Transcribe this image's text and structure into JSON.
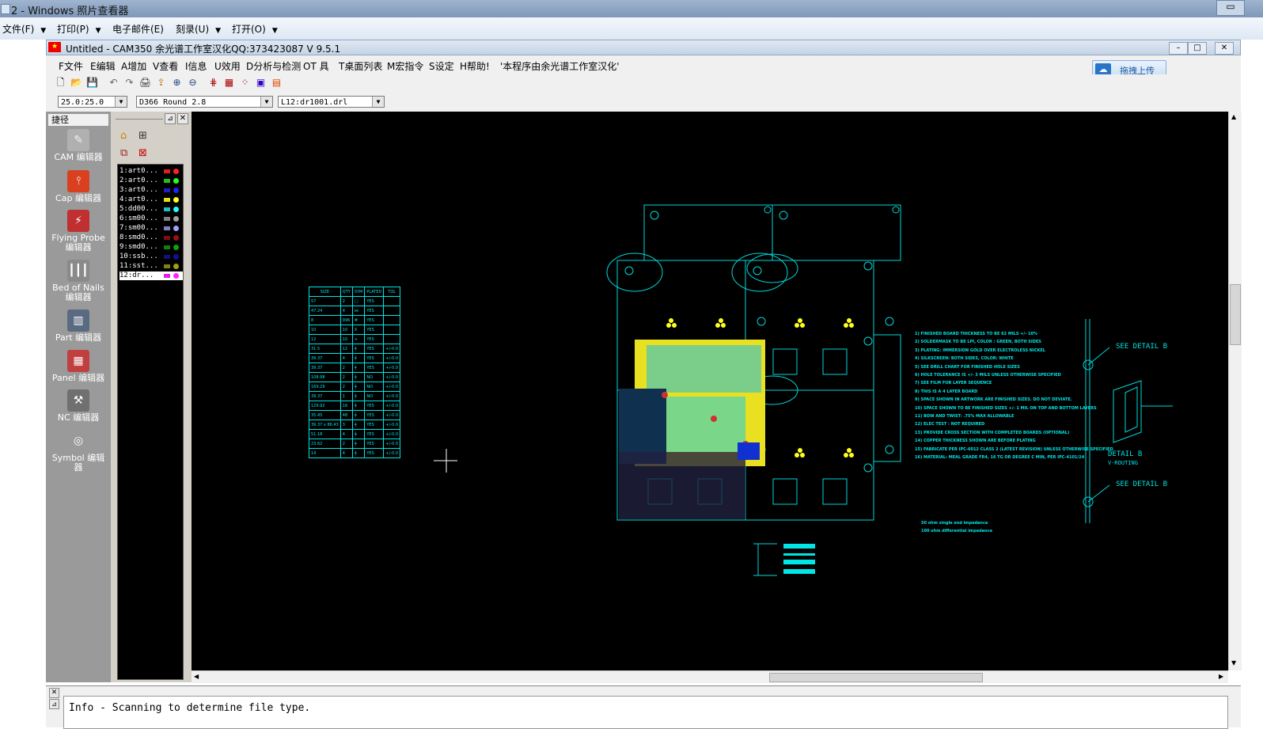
{
  "outer": {
    "title": "2 - Windows 照片查看器",
    "menu": [
      {
        "label": "文件(F)"
      },
      {
        "label": "打印(P)"
      },
      {
        "label": "电子邮件(E)"
      },
      {
        "label": "刻录(U)"
      },
      {
        "label": "打开(O)"
      }
    ]
  },
  "cam": {
    "title": "Untitled - CAM350 余光谱工作室汉化QQ:373423087 V 9.5.1",
    "menu": [
      "F文件",
      "E编辑",
      "A增加",
      "V查看",
      "I信息",
      "U效用",
      "D分析与检测",
      "OT 具",
      "T桌面列表",
      "M宏指令",
      "S设定",
      "H帮助!",
      "'本程序由余光谱工作室汉化'"
    ],
    "upload_button": "拖拽上传",
    "combos": {
      "grid": "25.0:25.0",
      "dcode": "D366  Round 2.8",
      "layer": "L12:dr1001.drl"
    },
    "panel_title": "捷径",
    "editors": [
      {
        "label": "CAM 编辑器",
        "icon": "cam-editor-icon"
      },
      {
        "label": "Cap 编辑器",
        "icon": "cap-editor-icon"
      },
      {
        "label": "Flying Probe 编辑器",
        "icon": "flying-probe-icon"
      },
      {
        "label": "Bed of Nails 编辑器",
        "icon": "bed-of-nails-icon"
      },
      {
        "label": "Part 编辑器",
        "icon": "part-editor-icon"
      },
      {
        "label": "Panel 编辑器",
        "icon": "panel-editor-icon"
      },
      {
        "label": "NC 编辑器",
        "icon": "nc-editor-icon"
      },
      {
        "label": "Symbol 编辑器",
        "icon": "symbol-editor-icon"
      }
    ],
    "layers": [
      {
        "label": "1:art0...",
        "c1": "#e02020",
        "c2": "#ff2020"
      },
      {
        "label": "2:art0...",
        "c1": "#20c020",
        "c2": "#20ff20"
      },
      {
        "label": "3:art0...",
        "c1": "#2020c0",
        "c2": "#2020ff"
      },
      {
        "label": "4:art0...",
        "c1": "#e0e020",
        "c2": "#ffff20"
      },
      {
        "label": "5:dd00...",
        "c1": "#20c0c0",
        "c2": "#20ffff"
      },
      {
        "label": "6:sm00...",
        "c1": "#808080",
        "c2": "#a0a0a0"
      },
      {
        "label": "7:sm00...",
        "c1": "#8080c0",
        "c2": "#a0a0ff"
      },
      {
        "label": "8:smd0...",
        "c1": "#801010",
        "c2": "#a01010"
      },
      {
        "label": "9:smd0...",
        "c1": "#108010",
        "c2": "#10a010"
      },
      {
        "label": "10:ssb...",
        "c1": "#101080",
        "c2": "#1010a0"
      },
      {
        "label": "11:sst...",
        "c1": "#808010",
        "c2": "#a0a010"
      },
      {
        "label": "12:dr...",
        "c1": "#e020e0",
        "c2": "#ff20ff",
        "selected": true
      }
    ],
    "info": "Info - Scanning to determine file type."
  },
  "drill_table": {
    "headers": [
      "SIZE",
      "QTY",
      "SYM",
      "PLATED",
      "TOL"
    ],
    "rows": [
      [
        "57",
        "2",
        "▢",
        "YES",
        ""
      ],
      [
        "47.24",
        "4",
        "⋈",
        "YES",
        ""
      ],
      [
        "8",
        "996",
        "#",
        "YES",
        ""
      ],
      [
        "10",
        "10",
        "X",
        "YES",
        ""
      ],
      [
        "12",
        "10",
        "+",
        "YES",
        ""
      ],
      [
        "31.5",
        "12",
        "╪",
        "YES",
        "+/-0.0"
      ],
      [
        "39.37",
        "4",
        "╪",
        "YES",
        "+/-0.0"
      ],
      [
        "39.37",
        "2",
        "╪",
        "YES",
        "+/-0.0"
      ],
      [
        "108.98",
        "2",
        "╪",
        "NO",
        "+/-0.0"
      ],
      [
        "169.29",
        "2",
        "╪",
        "NO",
        "+/-0.0"
      ],
      [
        "39.37",
        "1",
        "╪",
        "NO",
        "+/-0.0"
      ],
      [
        "129.92",
        "16",
        "╪",
        "YES",
        "+/-0.0"
      ],
      [
        "35.45",
        "48",
        "╪",
        "YES",
        "+/-0.0"
      ],
      [
        "39.37 x 86.43",
        "3",
        "╪",
        "YES",
        "+/-0.0"
      ],
      [
        "51.18",
        "4",
        "╪",
        "YES",
        "+/-0.0"
      ],
      [
        "23.62",
        "2",
        "╪",
        "YES",
        "+/-0.0"
      ],
      [
        "14",
        "4",
        "╪",
        "YES",
        "+/-0.0"
      ]
    ]
  },
  "drawing": {
    "see_detail_1": "SEE DETAIL B",
    "see_detail_2": "SEE DETAIL B",
    "detail_title": "DETAIL B",
    "detail_subtitle": "V-ROUTING",
    "notes": [
      "1) FINISHED BOARD THICKNESS TO BE 62 MILS +/- 10%",
      "2) SOLDERMASK TO BE LPI, COLOR : GREEN, BOTH SIDES",
      "3) PLATING: IMMERSION GOLD OVER ELECTROLESS NICKEL",
      "4) SILKSCREEN: BOTH SIDES, COLOR: WHITE",
      "5) SEE DRILL CHART FOR FINISHED HOLE SIZES",
      "6) HOLE TOLERANCE IS +/- 3 MILS UNLESS OTHERWISE SPECIFIED",
      "7) SEE FILM FOR LAYER SEQUENCE",
      "8) THIS IS A 4 LAYER BOARD",
      "9) SPACE SHOWN IN ARTWORK ARE FINISHED SIZES. DO NOT DEVIATE.",
      "10) SPACE SHOWN TO BE FINISHED SIZES +/- 1 MIL ON TOP AND BOTTOM LAYERS",
      "11) BOW AND TWIST: .75% MAX ALLOWABLE",
      "12) ELEC TEST : NOT REQUIRED",
      "13) PROVIDE CROSS SECTION WITH COMPLETED BOARDS (OPTIONAL)",
      "14) COPPER THICKNESS SHOWN ARE BEFORE PLATING",
      "15) FABRICATE PER IPC-6012 CLASS 2 (LATEST REVISION) UNLESS OTHERWISE SPECIFIED",
      "16) MATERIAL: MEAL GRADE FR4, 16 TG OR DEGREE C MIN, PER IPC-4101/24"
    ],
    "impedance_1": "50 ohm single end impedance",
    "impedance_2": "100 ohm differential impedance"
  }
}
